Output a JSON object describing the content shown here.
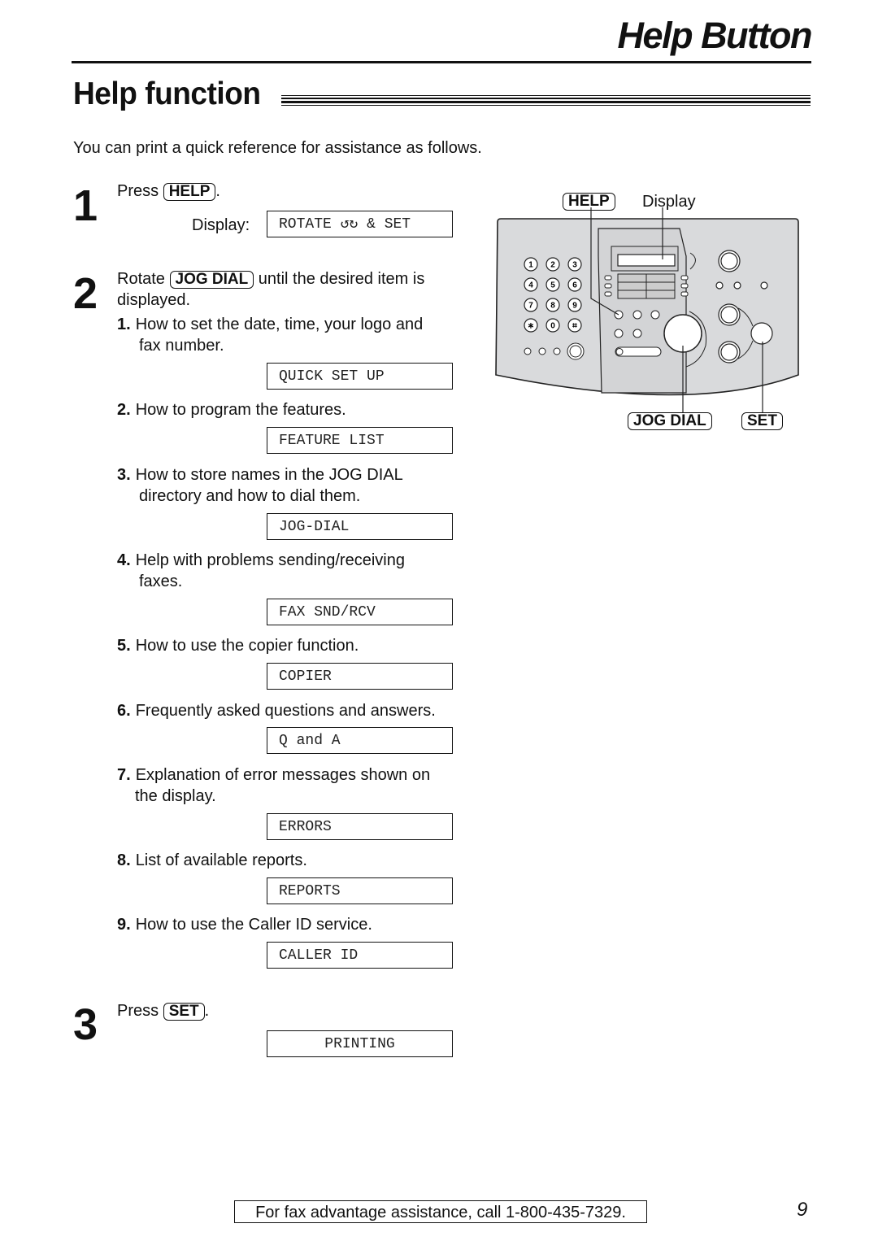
{
  "header": {
    "title": "Help Button"
  },
  "section": {
    "title": "Help function"
  },
  "intro": "You can print a quick reference for assistance as follows.",
  "steps": [
    {
      "number": "1",
      "prefix": "Press",
      "key": "HELP",
      "suffix": ".",
      "display_label": "Display:",
      "display": "ROTATE ↺↻ & SET"
    },
    {
      "number": "2",
      "prefix": "Rotate",
      "key": "JOG DIAL",
      "suffix": "until the desired item is",
      "line2": "displayed."
    },
    {
      "number": "3",
      "prefix": "Press",
      "key": "SET",
      "suffix": ".",
      "display": "PRINTING"
    }
  ],
  "items": [
    {
      "num": "1.",
      "text": "How to set the date, time, your logo and",
      "text2": "fax number.",
      "display": "QUICK SET UP"
    },
    {
      "num": "2.",
      "text": "How to program the features.",
      "display": "FEATURE LIST"
    },
    {
      "num": "3.",
      "text": "How to store names in the JOG DIAL",
      "text2": "directory and how to dial them.",
      "display": "JOG-DIAL"
    },
    {
      "num": "4.",
      "text": "Help with problems sending/receiving",
      "text2": "faxes.",
      "display": "FAX SND/RCV"
    },
    {
      "num": "5.",
      "text": "How to use the copier function.",
      "display": "COPIER"
    },
    {
      "num": "6.",
      "text": "Frequently asked questions and answers.",
      "display": "Q and A"
    },
    {
      "num": "7.",
      "text": "Explanation of error messages shown on",
      "text2": "the display.",
      "display": "ERRORS"
    },
    {
      "num": "8.",
      "text": "List of available reports.",
      "display": "REPORTS"
    },
    {
      "num": "9.",
      "text": "How to use the Caller ID service.",
      "display": "CALLER ID"
    }
  ],
  "diagram": {
    "labels": {
      "help": "HELP",
      "display": "Display",
      "jog_dial": "JOG DIAL",
      "set": "SET"
    },
    "keypad": [
      "1",
      "2",
      "3",
      "4",
      "5",
      "6",
      "7",
      "8",
      "9",
      "∗",
      "0",
      "⌗"
    ],
    "panel_color": "#d9dadc"
  },
  "footer": {
    "assistance": "For fax advantage assistance, call 1-800-435-7329.",
    "page": "9"
  }
}
